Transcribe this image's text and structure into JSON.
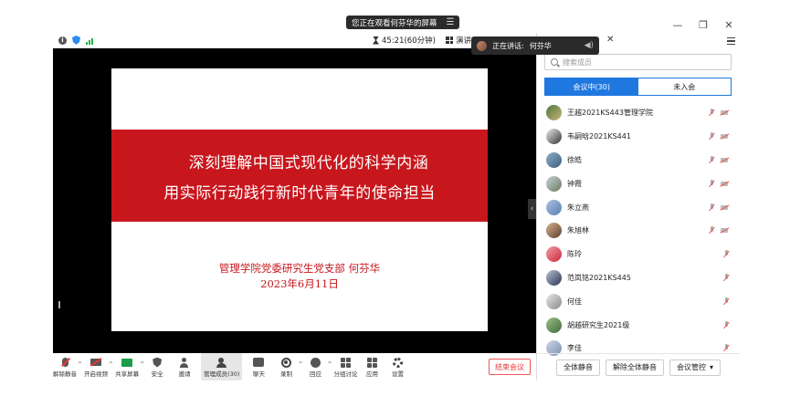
{
  "banner": {
    "text": "您正在观看何芬华的屏幕",
    "view_option_icon": "view-options-icon"
  },
  "window": {
    "icons": [
      "minimize-icon",
      "restore-icon",
      "close-icon"
    ]
  },
  "topbar": {
    "timer": "45:21(60分钟)",
    "presentation": "演讲"
  },
  "speaking": {
    "label": "正在讲话:",
    "name": "何芬华"
  },
  "slide": {
    "title_line1": "深刻理解中国式现代化的科学内涵",
    "title_line2": "用实际行动践行新时代青年的使命担当",
    "org": "管理学院党委研究生党支部   何芬华",
    "date": "2023年6月11日",
    "colors": {
      "band": "#c8161d",
      "text": "#c8161d"
    }
  },
  "toolbar": {
    "items": [
      {
        "label": "解除静音",
        "icon": "mic-muted-icon"
      },
      {
        "label": "开启视频",
        "icon": "camera-off-icon"
      },
      {
        "label": "共享屏幕",
        "icon": "share-screen-icon"
      },
      {
        "label": "安全",
        "icon": "shield-icon"
      },
      {
        "label": "邀请",
        "icon": "invite-icon"
      },
      {
        "label": "管理成员(30)",
        "icon": "participants-icon"
      },
      {
        "label": "聊天",
        "icon": "chat-icon"
      },
      {
        "label": "录制",
        "icon": "record-icon"
      },
      {
        "label": "回应",
        "icon": "reaction-icon"
      },
      {
        "label": "分组讨论",
        "icon": "breakout-icon"
      },
      {
        "label": "应用",
        "icon": "apps-icon"
      },
      {
        "label": "设置",
        "icon": "settings-icon"
      }
    ],
    "end_label": "结束会议",
    "accent": "#e33333"
  },
  "panel": {
    "search_placeholder": "搜索成员",
    "tab_in": "会议中(30)",
    "tab_out": "未入会",
    "accent": "#1f78e0",
    "participants": [
      {
        "name": "王越2021KS443管理学院",
        "camera": true
      },
      {
        "name": "韦嗣晗2021KS441",
        "camera": true
      },
      {
        "name": "徐皓",
        "camera": true
      },
      {
        "name": "钟霞",
        "camera": true
      },
      {
        "name": "朱立燕",
        "camera": true
      },
      {
        "name": "朱旭林",
        "camera": true
      },
      {
        "name": "陈玲",
        "camera": false
      },
      {
        "name": "范岚铭2021KS445",
        "camera": false
      },
      {
        "name": "何佳",
        "camera": false
      },
      {
        "name": "胡越研究生2021级",
        "camera": false
      },
      {
        "name": "李佳",
        "camera": false
      }
    ],
    "mute_all": "全体静音",
    "unmute_all": "解除全体静音",
    "manage": "会议管控"
  }
}
